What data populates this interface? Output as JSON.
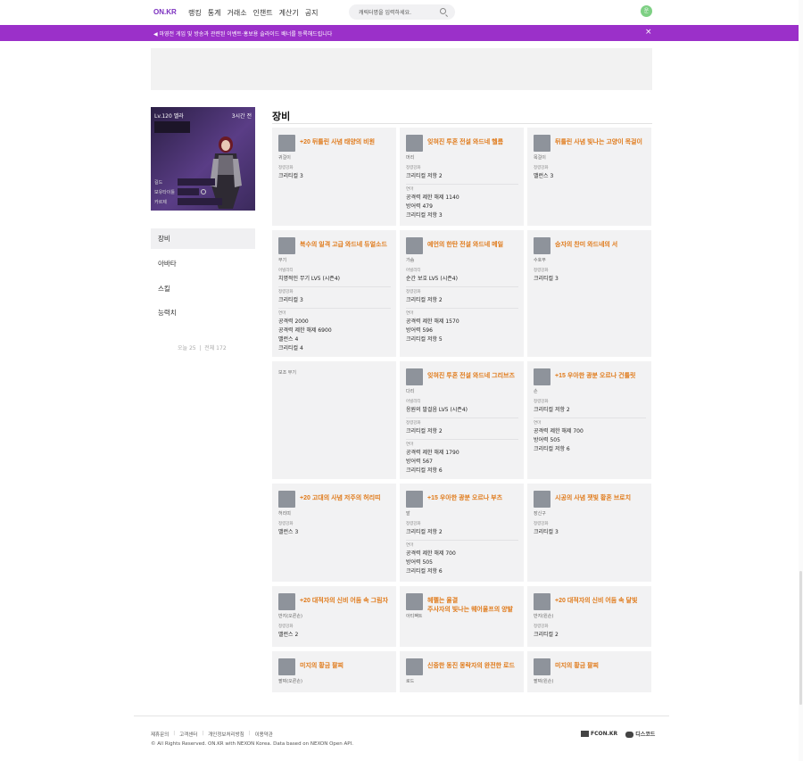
{
  "header": {
    "logo": "ON.KR",
    "nav": [
      "랭킹",
      "통계",
      "거래소",
      "인챈트",
      "계산기",
      "공지"
    ],
    "search_placeholder": "캐릭터명을 입력하세요.",
    "avatar_letter": "운"
  },
  "banner": {
    "text": "◀ 마영전 게임 및 방송과 관련된 이벤트·홍보용 슬라이드 배너를 등록해드립니다",
    "close": "×"
  },
  "character": {
    "level": "Lv.120 벨라",
    "time": "3시간 전",
    "rows": [
      "길드",
      "보유타이틀",
      "카르제"
    ]
  },
  "sidebar": {
    "items": [
      "장비",
      "아바타",
      "스킬",
      "능력치"
    ],
    "visits": "오늘 25  |  전체 172"
  },
  "section": {
    "title": "장비"
  },
  "items": [
    {
      "name": "+20 뒤틀린 사념 태양의 비원",
      "slot": "귀걸이",
      "groups": [
        {
          "label": "정령강화",
          "lines": [
            "크리티컬 3"
          ]
        }
      ]
    },
    {
      "name": "잊혀진 투혼 전설 와드네 헬름",
      "slot": "머리",
      "groups": [
        {
          "label": "정령강화",
          "lines": [
            "크리티컬 저항 2"
          ]
        },
        {
          "label": "연마",
          "lines": [
            "공격력 제한 해제 1140",
            "방어력 479",
            "크리티컬 저항 3"
          ]
        }
      ]
    },
    {
      "name": "뒤틀린 사념 빛나는 고양이 목걸이",
      "slot": "목걸이",
      "groups": [
        {
          "label": "정령강화",
          "lines": [
            "밸런스 3"
          ]
        }
      ]
    },
    {
      "name": "복수의 일격 고급 와드네 듀얼소드",
      "slot": "무기",
      "groups": [
        {
          "label": "어빌리티",
          "lines": [
            "치명적인 무기 LV5 (시즌4)"
          ]
        },
        {
          "label": "정령강화",
          "lines": [
            "크리티컬 3"
          ]
        },
        {
          "label": "연마",
          "lines": [
            "공격력 2000",
            "공격력 제한 해제 6900",
            "밸런스 4",
            "크리티컬 4"
          ]
        }
      ]
    },
    {
      "name": "예언의 한탄 전설 와드네 메일",
      "slot": "가슴",
      "groups": [
        {
          "label": "어빌리티",
          "lines": [
            "순간 보호 LV5 (시즌4)"
          ]
        },
        {
          "label": "정령강화",
          "lines": [
            "크리티컬 저항 2"
          ]
        },
        {
          "label": "연마",
          "lines": [
            "공격력 제한 해제 1570",
            "방어력 596",
            "크리티컬 저항 5"
          ]
        }
      ]
    },
    {
      "name": "승자의 찬미 와드네의 서",
      "slot": "수호부",
      "groups": [
        {
          "label": "정령강화",
          "lines": [
            "크리티컬 3"
          ]
        }
      ]
    },
    {
      "name": "",
      "slot": "보조 무기",
      "groups": []
    },
    {
      "name": "잊혀진 투혼 전설 와드네 그리브즈",
      "slot": "다리",
      "groups": [
        {
          "label": "어빌리티",
          "lines": [
            "응원의 발걸음 LV5 (시즌4)"
          ]
        },
        {
          "label": "정령강화",
          "lines": [
            "크리티컬 저항 2"
          ]
        },
        {
          "label": "연마",
          "lines": [
            "공격력 제한 해제 1790",
            "방어력 567",
            "크리티컬 저항 6"
          ]
        }
      ]
    },
    {
      "name": "+15 우아한 광분 오르나 건틀릿",
      "slot": "손",
      "groups": [
        {
          "label": "정령강화",
          "lines": [
            "크리티컬 저항 2"
          ]
        },
        {
          "label": "연마",
          "lines": [
            "공격력 제한 해제 700",
            "방어력 505",
            "크리티컬 저항 6"
          ]
        }
      ]
    },
    {
      "name": "+20 고대의 사념 저주의 허리띠",
      "slot": "허리띠",
      "groups": [
        {
          "label": "정령강화",
          "lines": [
            "밸런스 3"
          ]
        }
      ]
    },
    {
      "name": "+15 우아한 광분 오르나 부츠",
      "slot": "발",
      "groups": [
        {
          "label": "정령강화",
          "lines": [
            "크리티컬 저항 2"
          ]
        },
        {
          "label": "연마",
          "lines": [
            "공격력 제한 해제 700",
            "방어력 505",
            "크리티컬 저항 6"
          ]
        }
      ]
    },
    {
      "name": "시공의 사념 잿빛 황혼 브로치",
      "slot": "장신구",
      "groups": [
        {
          "label": "정령강화",
          "lines": [
            "크리티컬 3"
          ]
        }
      ]
    },
    {
      "name": "+20 대적자의 신비 어둠 속 그림자",
      "slot": "반지(오른손)",
      "groups": [
        {
          "label": "정령강화",
          "lines": [
            "밸런스 2"
          ]
        }
      ]
    },
    {
      "name": "헤펠는 율결\n주사자의 빛나는 웨어울프의 양발",
      "slot": "아티팩트",
      "groups": []
    },
    {
      "name": "+20 대적자의 신비 어둠 속 달빛",
      "slot": "반지(왼손)",
      "groups": [
        {
          "label": "정령강화",
          "lines": [
            "크리티컬 2"
          ]
        }
      ]
    },
    {
      "name": "미지의 황금 팔찌",
      "slot": "팔찌(오른손)",
      "groups": []
    },
    {
      "name": "신중한 동진 몽락자의 완전한 로드",
      "slot": "로드",
      "groups": []
    },
    {
      "name": "미지의 황금 팔찌",
      "slot": "팔찌(왼손)",
      "groups": []
    }
  ],
  "footer": {
    "links": [
      "제휴문의",
      "고객센터",
      "개인정보처리방침",
      "이용약관"
    ],
    "copyright": "© All Rights Reserved. ON.KR with NEXON Korea. Data based on NEXON Open API.",
    "fcon": "FCON.KR",
    "discord": "디스코드"
  }
}
